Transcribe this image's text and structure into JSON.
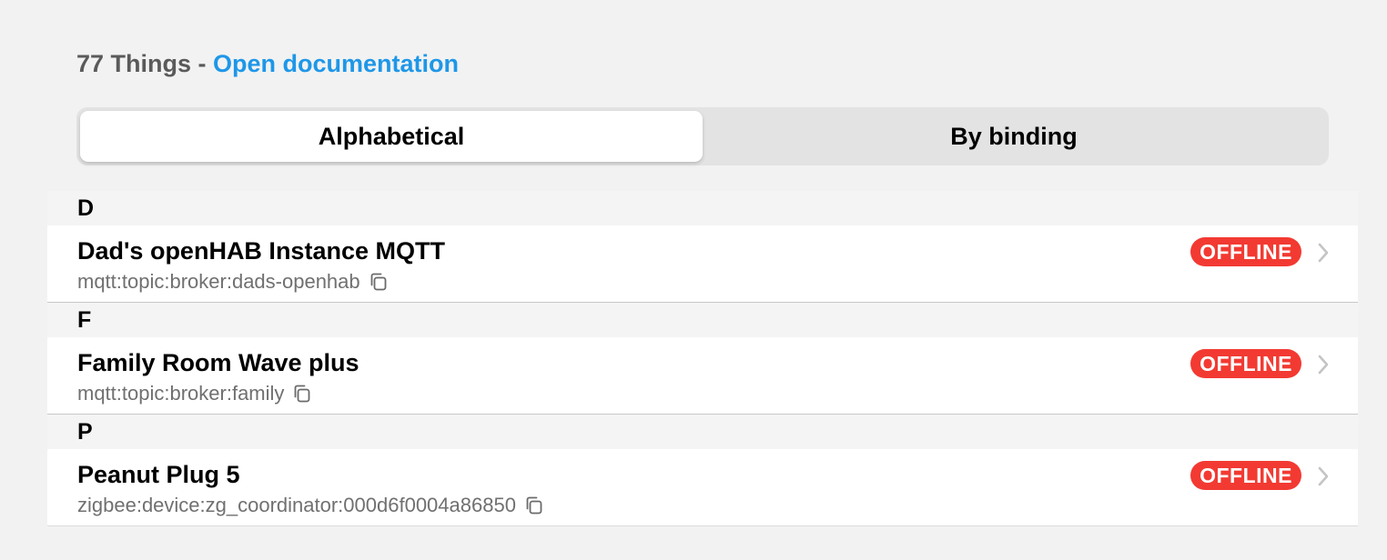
{
  "header": {
    "count_label": "77 Things",
    "separator": " - ",
    "doc_link": "Open documentation"
  },
  "segments": [
    {
      "label": "Alphabetical",
      "active": true
    },
    {
      "label": "By binding",
      "active": false
    }
  ],
  "groups": [
    {
      "letter": "D",
      "items": [
        {
          "title": "Dad's openHAB Instance MQTT",
          "uid": "mqtt:topic:broker:dads-openhab",
          "status": "OFFLINE"
        }
      ]
    },
    {
      "letter": "F",
      "items": [
        {
          "title": "Family Room Wave plus",
          "uid": "mqtt:topic:broker:family",
          "status": "OFFLINE"
        }
      ]
    },
    {
      "letter": "P",
      "items": [
        {
          "title": "Peanut Plug 5",
          "uid": "zigbee:device:zg_coordinator:000d6f0004a86850",
          "status": "OFFLINE"
        }
      ]
    }
  ],
  "icons": {
    "copy": "copy-icon",
    "chevron": "chevron-right-icon"
  },
  "colors": {
    "link": "#1e97e8",
    "status_offline": "#f23a32"
  }
}
